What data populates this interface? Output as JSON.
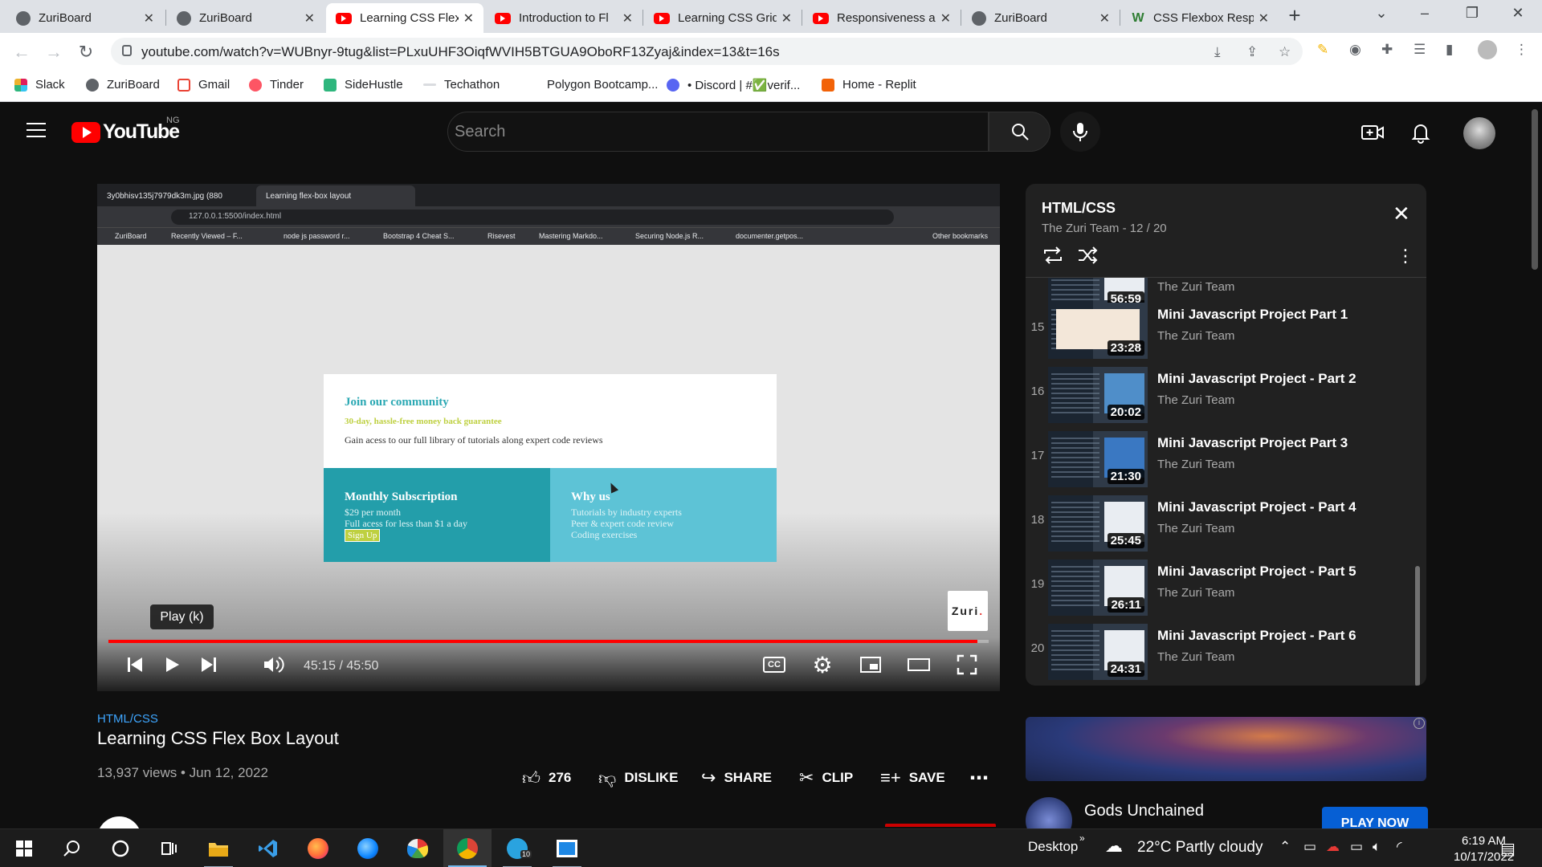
{
  "browser": {
    "tabs": [
      {
        "label": "ZuriBoard",
        "icon": "globe-icon"
      },
      {
        "label": "ZuriBoard",
        "icon": "globe-icon"
      },
      {
        "label": "Learning CSS Flex",
        "icon": "youtube-icon"
      },
      {
        "label": "Introduction to Fl",
        "icon": "youtube-icon"
      },
      {
        "label": "Learning CSS Grid",
        "icon": "youtube-icon"
      },
      {
        "label": "Responsiveness a",
        "icon": "youtube-icon"
      },
      {
        "label": "ZuriBoard",
        "icon": "globe-icon"
      },
      {
        "label": "CSS Flexbox Resp",
        "icon": "wikipedia-icon"
      }
    ],
    "close_glyph": "✕",
    "new_tab_glyph": "+",
    "url": "youtube.com/watch?v=WUBnyr-9tug&list=PLxuUHF3OiqfWVIH5BTGUA9OboRF13Zyaj&index=13&t=16s",
    "bookmarks": [
      "Slack",
      "ZuriBoard",
      "Gmail",
      "Tinder",
      "SideHustle",
      "Techathon",
      "Polygon Bootcamp...",
      "• Discord | #✅verif...",
      "Home - Replit"
    ]
  },
  "youtube": {
    "logo_text": "YouTube",
    "region": "NG",
    "search_placeholder": "Search"
  },
  "player": {
    "inner_tabs": [
      "3y0bhisv135j7979dk3m.jpg (880",
      "Learning flex-box layout"
    ],
    "inner_url": "127.0.0.1:5500/index.html",
    "inner_bookmarks": [
      "ZuriBoard",
      "Recently Viewed – F...",
      "node js password r...",
      "Bootstrap 4 Cheat S...",
      "Risevest",
      "Mastering Markdo...",
      "Securing Node.js R...",
      "documenter.getpos...",
      "Other bookmarks"
    ],
    "card": {
      "title": "Join our community",
      "subtitle": "30-day, hassle-free money back guarantee",
      "description": "Gain acess to our full library of tutorials along expert code reviews",
      "left_title": "Monthly Subscription",
      "left_lines": [
        "$29 per month",
        "Full acess for less than $1 a day"
      ],
      "left_button": "Sign Up",
      "right_title": "Why us",
      "right_lines": [
        "Tutorials by industry experts",
        "Peer & expert code review",
        "Coding exercises"
      ]
    },
    "watermark": "Zuri",
    "watermark_dot": ".",
    "tooltip": "Play (k)",
    "time": "45:15 / 45:50",
    "progress": 0.987,
    "cc_label": "CC"
  },
  "video": {
    "tag": "HTML/CSS",
    "title": "Learning CSS Flex Box Layout",
    "meta": "13,937 views • Jun 12, 2022",
    "actions": {
      "likes": "276",
      "dislike": "DISLIKE",
      "share": "SHARE",
      "clip": "CLIP",
      "save": "SAVE",
      "more": "⋯"
    }
  },
  "playlist": {
    "title": "HTML/CSS",
    "subtitle": "The Zuri Team - 12 / 20",
    "partial_item": {
      "duration": "56:59",
      "channel": "The Zuri Team"
    },
    "items": [
      {
        "index": "15",
        "title": "Mini Javascript Project Part 1",
        "channel": "The Zuri Team",
        "duration": "23:28"
      },
      {
        "index": "16",
        "title": "Mini Javascript Project - Part 2",
        "channel": "The Zuri Team",
        "duration": "20:02"
      },
      {
        "index": "17",
        "title": "Mini Javascript Project Part 3",
        "channel": "The Zuri Team",
        "duration": "21:30"
      },
      {
        "index": "18",
        "title": "Mini Javascript Project - Part 4",
        "channel": "The Zuri Team",
        "duration": "25:45"
      },
      {
        "index": "19",
        "title": "Mini Javascript Project - Part 5",
        "channel": "The Zuri Team",
        "duration": "26:11"
      },
      {
        "index": "20",
        "title": "Mini Javascript Project - Part 6",
        "channel": "The Zuri Team",
        "duration": "24:31"
      }
    ]
  },
  "ad": {
    "title": "Gods Unchained",
    "button": "PLAY NOW",
    "info_glyph": "i"
  },
  "taskbar": {
    "desktop_label": "Desktop",
    "weather": "22°C  Partly cloudy",
    "time": "6:19 AM",
    "date": "10/17/2022",
    "telegram_badge": "10"
  },
  "colors": {
    "accent_red": "#ff0000",
    "link_blue": "#3ea6ff",
    "card_teal": "#239eaa",
    "card_light_teal": "#5dc3d6",
    "card_green": "#bed040"
  }
}
